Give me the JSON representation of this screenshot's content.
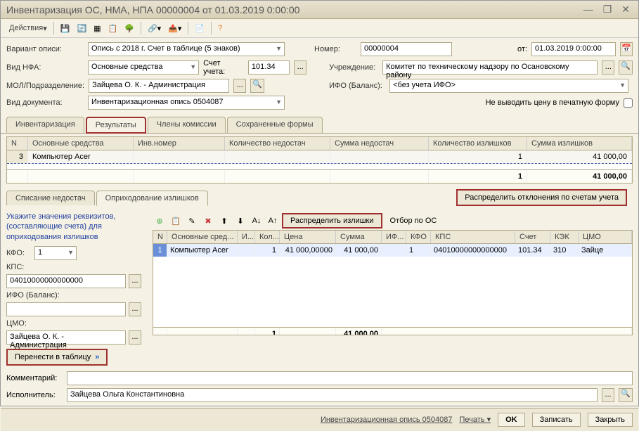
{
  "title": "Инвентаризация ОС, НМА, НПА 00000004 от 01.03.2019 0:00:00",
  "toolbar": {
    "actions": "Действия"
  },
  "form": {
    "variant_label": "Вариант описи:",
    "variant_value": "Опись с 2018 г. Счет в таблице (5 знаков)",
    "number_label": "Номер:",
    "number_value": "00000004",
    "from_label": "от:",
    "date_value": "01.03.2019 0:00:00",
    "nfa_label": "Вид НФА:",
    "nfa_value": "Основные средства",
    "account_label": "Счет учета:",
    "account_value": "101.34",
    "org_label": "Учреждение:",
    "org_value": "Комитет по техническому надзору по Осановскому району",
    "mol_label": "МОЛ/Подразделение:",
    "mol_value": "Зайцева О. К. - Администрация",
    "ifo_label": "ИФО (Баланс):",
    "ifo_value": "<без учета ИФО>",
    "doc_label": "Вид документа:",
    "doc_value": "Инвентаризационная опись 0504087",
    "noprint_label": "Не выводить цену в печатную форму"
  },
  "tabs": [
    "Инвентаризация",
    "Результаты",
    "Члены комиссии",
    "Сохраненные формы"
  ],
  "grid": {
    "headers": [
      "N",
      "Основные средства",
      "Инв.номер",
      "Количество недостач",
      "Сумма недостач",
      "Количество излишков",
      "Сумма излишков"
    ],
    "row": {
      "n": "3",
      "name": "Компьютер  Acer",
      "inv": "",
      "qty_short": "",
      "sum_short": "",
      "qty_over": "1",
      "sum_over": "41 000,00"
    },
    "footer": {
      "qty_over": "1",
      "sum_over": "41 000,00"
    }
  },
  "distribute_accounts": "Распределить отклонения по счетам учета",
  "subtabs": [
    "Списание недостач",
    "Оприходование излишков"
  ],
  "left": {
    "hint": "Укажите значения реквизитов, (составляющие  счета) для оприходования излишков",
    "kfo_label": "КФО:",
    "kfo_value": "1",
    "kps_label": "КПС:",
    "kps_value": "04010000000000000",
    "ifo_label": "ИФО (Баланс):",
    "ifo_value": "",
    "cmo_label": "ЦМО:",
    "cmo_value": "Зайцева О. К. - Администрация",
    "transfer": "Перенести в таблицу"
  },
  "detail_toolbar": {
    "distribute": "Распределить излишки",
    "filter": "Отбор по ОС"
  },
  "detail": {
    "headers": [
      "N",
      "Основные сред...",
      "И...",
      "Кол...",
      "Цена",
      "Сумма",
      "ИФ...",
      "КФО",
      "КПС",
      "Счет",
      "КЭК",
      "ЦМО"
    ],
    "row": {
      "n": "1",
      "name": "Компьютер  Acer",
      "inv": "",
      "qty": "1",
      "price": "41 000,00000",
      "sum": "41 000,00",
      "ifo": "",
      "kfo": "1",
      "kps": "04010000000000000",
      "acct": "101.34",
      "kek": "310",
      "cmo": "Зайце"
    },
    "footer": {
      "qty": "1",
      "sum": "41 000,00"
    }
  },
  "bottom": {
    "comment_label": "Комментарий:",
    "comment_value": "",
    "executor_label": "Исполнитель:",
    "executor_value": "Зайцева Ольга Константиновна"
  },
  "status": {
    "doc": "Инвентаризационная опись 0504087",
    "print": "Печать",
    "ok": "OK",
    "save": "Записать",
    "close": "Закрыть"
  }
}
